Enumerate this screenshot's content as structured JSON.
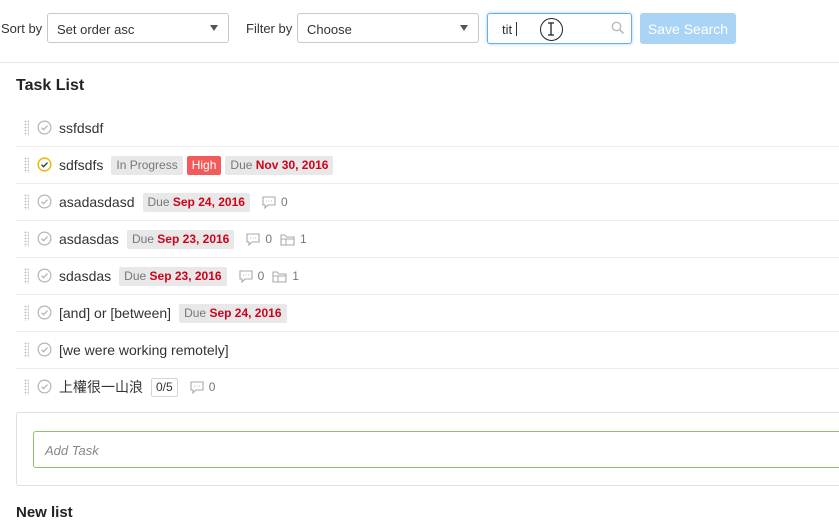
{
  "toolbar": {
    "sort_label": "Sort by",
    "sort_value": "Set order asc",
    "filter_label": "Filter by",
    "filter_value": "Choose",
    "search_value": "tit",
    "save_label": "Save Search"
  },
  "list": {
    "title": "Task List",
    "tasks": [
      {
        "name": "ssfdsdf",
        "state": "done"
      },
      {
        "name": "sdfsdfs",
        "state": "in-progress",
        "status": "In Progress",
        "priority": "High",
        "due_prefix": "Due",
        "due": "Nov 30, 2016"
      },
      {
        "name": "asadasdasd",
        "state": "done",
        "due_prefix": "Due",
        "due": "Sep 24, 2016",
        "comments": "0"
      },
      {
        "name": "asdasdas",
        "state": "done",
        "due_prefix": "Due",
        "due": "Sep 23, 2016",
        "comments": "0",
        "files": "1"
      },
      {
        "name": "sdasdas",
        "state": "done",
        "due_prefix": "Due",
        "due": "Sep 23, 2016",
        "comments": "0",
        "files": "1"
      },
      {
        "name": "[and] or [between]",
        "state": "done",
        "due_prefix": "Due",
        "due": "Sep 24, 2016"
      },
      {
        "name": "[we were working remotely]",
        "state": "done"
      },
      {
        "name": "上權很一山浪",
        "state": "done",
        "checklist": "0/5",
        "comments": "0"
      }
    ],
    "add_placeholder": "Add Task"
  },
  "next_list": {
    "title": "New list"
  },
  "colors": {
    "accent": "#a9d4f5",
    "due": "#d0021b",
    "high": "#f15b5b",
    "progress_check": "#f0b400",
    "add_border": "#8cc36d"
  }
}
